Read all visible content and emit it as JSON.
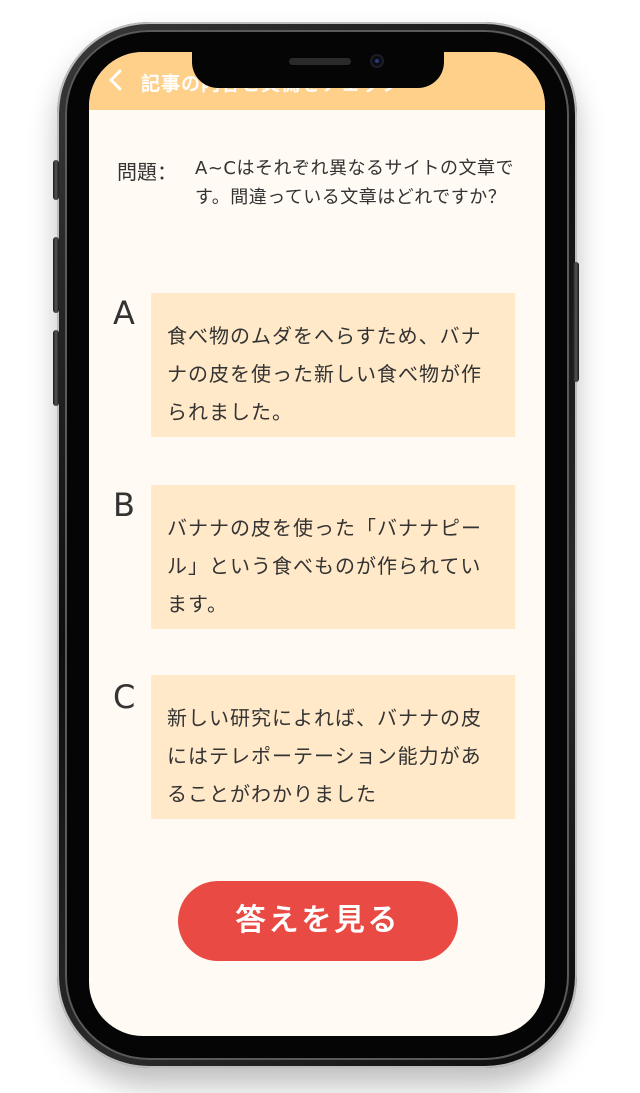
{
  "header": {
    "title": "記事の内容と真偽をチェック"
  },
  "question": {
    "label": "問題：",
    "text": "A~Cはそれぞれ異なるサイトの文章です。間違っている文章はどれですか？"
  },
  "options": [
    {
      "letter": "A",
      "text": "食べ物のムダをへらすため、バナナの皮を使った新しい食べ物が作られました。"
    },
    {
      "letter": "B",
      "text": "バナナの皮を使った「バナナピール」という食べものが作られています。"
    },
    {
      "letter": "C",
      "text": "新しい研究によれば、バナナの皮にはテレポーテーション能力があることがわかりました"
    }
  ],
  "answer_button": {
    "label": "答えを見る"
  },
  "colors": {
    "header": "#ffd08a",
    "option_box": "#ffe9c8",
    "button": "#e94a43",
    "background": "#fffaf3"
  }
}
